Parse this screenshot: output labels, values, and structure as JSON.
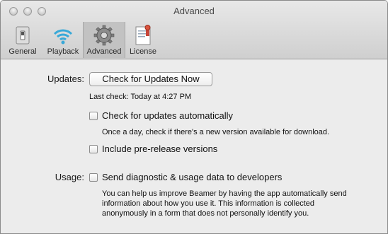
{
  "window": {
    "title": "Advanced"
  },
  "tabs": [
    {
      "label": "General"
    },
    {
      "label": "Playback"
    },
    {
      "label": "Advanced"
    },
    {
      "label": "License"
    }
  ],
  "updates": {
    "section_label": "Updates:",
    "button_label": "Check for Updates Now",
    "last_check": "Last check: Today at 4:27 PM",
    "auto_label": "Check for updates automatically",
    "auto_desc": "Once a day, check if there's a new version available for download.",
    "prerelease_label": "Include pre-release versions"
  },
  "usage": {
    "section_label": "Usage:",
    "diag_label": "Send diagnostic & usage data to developers",
    "diag_desc_1": "You can help us improve Beamer by having the app automatically send",
    "diag_desc_2": "information about how you use it. This information is collected",
    "diag_desc_3": "anonymously in a form that does not personally identify you."
  }
}
